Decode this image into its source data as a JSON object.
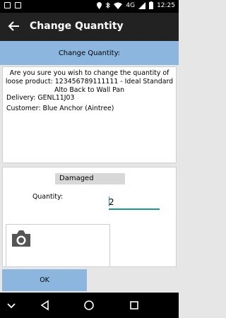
{
  "status_bar": {
    "network": "4G",
    "time": "12:25"
  },
  "app_bar": {
    "title": "Change Quantity"
  },
  "header": {
    "label": "Change Quantity:"
  },
  "confirm": {
    "question": "Are you sure you wish to change the quantity of loose product: 123456789111111 - Ideal Standard Alto Back to Wall Pan",
    "delivery": "Delivery: GENL11J03",
    "customer": "Customer: Blue Anchor (Aintree)"
  },
  "form": {
    "reason_selected": "Damaged",
    "quantity_label": "Quantity:",
    "quantity_value": "2"
  },
  "actions": {
    "ok_label": "OK"
  },
  "icons": {
    "back": "arrow-back-icon",
    "camera": "camera-icon",
    "nav": [
      "chevron-down-icon",
      "back-triangle-icon",
      "home-circle-icon",
      "recents-square-icon"
    ]
  },
  "colors": {
    "accent": "#8db6df",
    "app_bar": "#222222",
    "input_underline": "#1a9a8c"
  }
}
